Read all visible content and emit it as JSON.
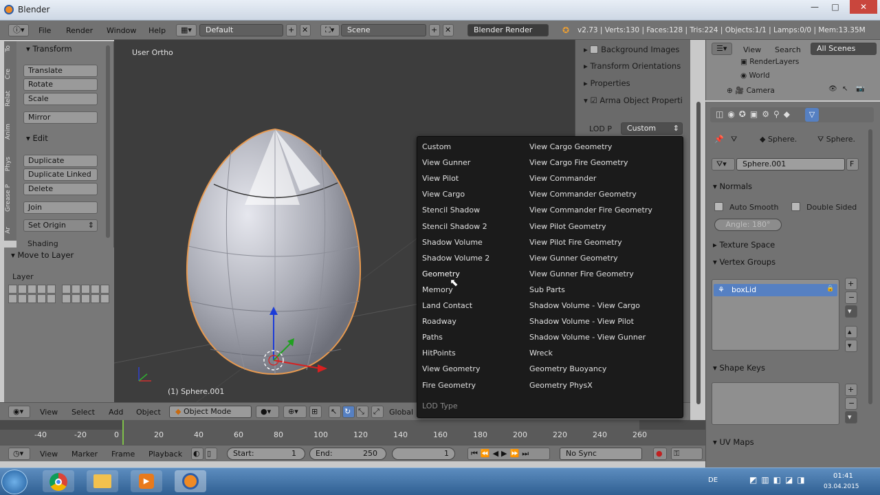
{
  "window": {
    "title": "Blender",
    "controls": [
      "—",
      "□",
      "✕"
    ]
  },
  "header": {
    "menus": [
      "File",
      "Render",
      "Window",
      "Help"
    ],
    "screen_layout": "Default",
    "scene": "Scene",
    "render_engine": "Blender Render",
    "info": "v2.73 | Verts:130 | Faces:128 | Tris:224 | Objects:1/1 | Lamps:0/0 | Mem:13.35M"
  },
  "tool_tabs": [
    "To",
    "Cre",
    "Relat",
    "Anim",
    "Phys",
    "Grease P",
    "Ar"
  ],
  "transform": {
    "heading": "Transform",
    "buttons": [
      "Translate",
      "Rotate",
      "Scale",
      "Mirror"
    ]
  },
  "edit": {
    "heading": "Edit",
    "buttons": [
      "Duplicate",
      "Duplicate Linked",
      "Delete",
      "Join"
    ],
    "set_origin": "Set Origin",
    "shading": "Shading"
  },
  "move_to_layer": {
    "heading": "Move to Layer",
    "layer_label": "Layer"
  },
  "viewport": {
    "view_label": "User Ortho",
    "object_label": "(1) Sphere.001"
  },
  "npanel": {
    "rows": [
      "Background Images",
      "Transform Orientations",
      "Properties",
      "Arma Object Properti"
    ],
    "lod_label": "LOD P",
    "lod_value": "Custom"
  },
  "dropdown": {
    "left": [
      "Custom",
      "View Gunner",
      "View Pilot",
      "View Cargo",
      "Stencil Shadow",
      "Stencil Shadow 2",
      "Shadow Volume",
      "Shadow Volume 2",
      "Geometry",
      "Memory",
      "Land Contact",
      "Roadway",
      "Paths",
      "HitPoints",
      "View Geometry",
      "Fire Geometry"
    ],
    "right": [
      "View Cargo Geometry",
      "View Cargo Fire Geometry",
      "View Commander",
      "View Commander Geometry",
      "View Commander Fire Geometry",
      "View Pilot Geometry",
      "View Pilot Fire Geometry",
      "View Gunner Geometry",
      "View Gunner Fire Geometry",
      "Sub Parts",
      "Shadow Volume - View Cargo",
      "Shadow Volume - View Pilot",
      "Shadow Volume - View Gunner",
      "Wreck",
      "Geometry Buoyancy",
      "Geometry PhysX"
    ],
    "footer": "LOD Type",
    "selected": "Geometry"
  },
  "outliner": {
    "menus": [
      "View",
      "Search"
    ],
    "filter": "All Scenes",
    "items": [
      "RenderLayers",
      "World",
      "Camera"
    ]
  },
  "properties": {
    "breadcrumb": [
      "Sphere.",
      "Sphere."
    ],
    "mesh_name": "Sphere.001",
    "fake_user": "F",
    "normals": {
      "heading": "Normals",
      "auto_smooth": "Auto Smooth",
      "double_sided": "Double Sided",
      "angle": "Angle:  180°"
    },
    "texture_space": "Texture Space",
    "vertex_groups": {
      "heading": "Vertex Groups",
      "items": [
        "boxLid"
      ]
    },
    "shape_keys": "Shape Keys",
    "uv_maps": "UV Maps"
  },
  "viewport_header": {
    "menus": [
      "View",
      "Select",
      "Add",
      "Object"
    ],
    "mode": "Object Mode",
    "orientation": "Global"
  },
  "timeline": {
    "ticks": [
      "-40",
      "-20",
      "0",
      "20",
      "40",
      "60",
      "80",
      "100",
      "120",
      "140",
      "160",
      "180",
      "200",
      "220",
      "240",
      "260"
    ],
    "menus": [
      "View",
      "Marker",
      "Frame",
      "Playback"
    ],
    "start_label": "Start:",
    "start_value": "1",
    "end_label": "End:",
    "end_value": "250",
    "current": "1",
    "sync": "No Sync"
  },
  "taskbar": {
    "clock_time": "01:41",
    "clock_date": "03.04.2015",
    "lang": "DE"
  },
  "colors": {
    "selection": "#5680c2",
    "viewport": "#3d3d3d",
    "dropdown_bg": "#1b1b1b"
  }
}
